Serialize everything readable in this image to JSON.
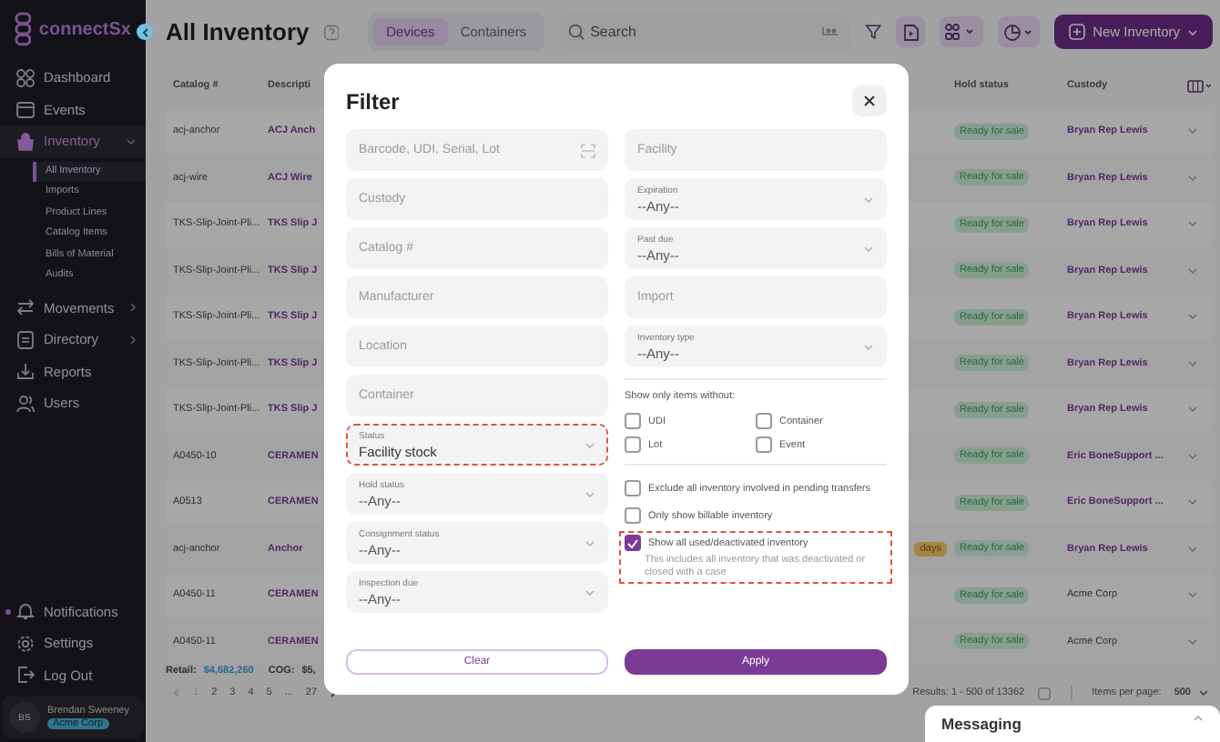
{
  "sidebar": {
    "brand": "connectSx",
    "nav": [
      {
        "label": "Dashboard",
        "selected": false
      },
      {
        "label": "Events",
        "selected": false
      },
      {
        "label": "Inventory",
        "selected": true,
        "expanded": true,
        "children": [
          {
            "label": "All Inventory",
            "selected": true
          },
          {
            "label": "Imports",
            "selected": false
          },
          {
            "label": "Product Lines",
            "selected": false
          },
          {
            "label": "Catalog Items",
            "selected": false
          },
          {
            "label": "Bills of Material",
            "selected": false
          },
          {
            "label": "Audits",
            "selected": false
          }
        ]
      },
      {
        "label": "Movements",
        "selected": false,
        "expanded": false
      },
      {
        "label": "Directory",
        "selected": false,
        "expanded": false
      },
      {
        "label": "Reports",
        "selected": false
      },
      {
        "label": "Users",
        "selected": false
      }
    ],
    "bottom_nav": [
      {
        "label": "Notifications",
        "unread": true
      },
      {
        "label": "Settings",
        "unread": false
      },
      {
        "label": "Log Out",
        "unread": false
      }
    ],
    "user": {
      "initials": "BS",
      "name": "Brendan Sweeney",
      "org": "Acme Corp"
    }
  },
  "header": {
    "title": "All Inventory",
    "tabs": [
      {
        "label": "Devices",
        "selected": true
      },
      {
        "label": "Containers",
        "selected": false
      }
    ],
    "search": {
      "placeholder": "Search"
    },
    "new_button": "New Inventory"
  },
  "table": {
    "columns": {
      "catalog": "Catalog #",
      "description": "Descripti",
      "hold_status": "Hold status",
      "custody": "Custody"
    },
    "rows": [
      {
        "catalog": "acj-anchor",
        "description": "ACJ Anch",
        "hold_status": "Ready for sale",
        "custody": "Bryan Rep Lewis",
        "custody_link": true
      },
      {
        "catalog": "acj-wire",
        "description": "ACJ Wire",
        "hold_status": "Ready for sale",
        "custody": "Bryan Rep Lewis",
        "custody_link": true
      },
      {
        "catalog": "TKS-Slip-Joint-Pli...",
        "description": "TKS Slip J",
        "hold_status": "Ready for sale",
        "custody": "Bryan Rep Lewis",
        "custody_link": true
      },
      {
        "catalog": "TKS-Slip-Joint-Pli...",
        "description": "TKS Slip J",
        "hold_status": "Ready for sale",
        "custody": "Bryan Rep Lewis",
        "custody_link": true
      },
      {
        "catalog": "TKS-Slip-Joint-Pli...",
        "description": "TKS Slip J",
        "hold_status": "Ready for sale",
        "custody": "Bryan Rep Lewis",
        "custody_link": true
      },
      {
        "catalog": "TKS-Slip-Joint-Pli...",
        "description": "TKS Slip J",
        "hold_status": "Ready for sale",
        "custody": "Bryan Rep Lewis",
        "custody_link": true
      },
      {
        "catalog": "TKS-Slip-Joint-Pli...",
        "description": "TKS Slip J",
        "hold_status": "Ready for sale",
        "custody": "Bryan Rep Lewis",
        "custody_link": true
      },
      {
        "catalog": "A0450-10",
        "description": "CERAMEN",
        "hold_status": "Ready for sale",
        "custody": "Eric BoneSupport ...",
        "custody_link": true
      },
      {
        "catalog": "A0513",
        "description": "CERAMEN",
        "hold_status": "Ready for sale",
        "custody": "Eric BoneSupport ...",
        "custody_link": true
      },
      {
        "catalog": "acj-anchor",
        "description": "Anchor",
        "due_badge": "days",
        "hold_status": "Ready for sale",
        "custody": "Bryan Rep Lewis",
        "custody_link": true
      },
      {
        "catalog": "A0450-11",
        "description": "CERAMEN",
        "hold_status": "Ready for sale",
        "custody": "Acme Corp",
        "custody_link": false
      },
      {
        "catalog": "A0450-11",
        "description": "CERAMEN",
        "hold_status": "Ready for sale",
        "custody": "Acme Corp",
        "custody_link": false
      }
    ]
  },
  "totals": {
    "retail_label": "Retail:",
    "retail_value": "$4,682,260",
    "cog_label": "COG:",
    "cog_value": "$5,"
  },
  "pagination": {
    "pages": [
      {
        "label": "1",
        "selected": true
      },
      {
        "label": "2",
        "selected": false
      },
      {
        "label": "3",
        "selected": false
      },
      {
        "label": "4",
        "selected": false
      },
      {
        "label": "5",
        "selected": false
      },
      {
        "label": "...",
        "selected": false
      },
      {
        "label": "27",
        "selected": false
      }
    ],
    "results": "Results: 1 - 500 of 13362",
    "per_page_label": "Items per page:",
    "per_page": "500"
  },
  "filter": {
    "title": "Filter",
    "left_fields": [
      {
        "kind": "text",
        "placeholder": "Barcode, UDI, Serial, Lot",
        "scan": true,
        "highlighted": false
      },
      {
        "kind": "text",
        "placeholder": "Custody",
        "scan": false,
        "highlighted": false
      },
      {
        "kind": "text",
        "placeholder": "Catalog #",
        "scan": false,
        "highlighted": false
      },
      {
        "kind": "text",
        "placeholder": "Manufacturer",
        "scan": false,
        "highlighted": false
      },
      {
        "kind": "text",
        "placeholder": "Location",
        "scan": false,
        "highlighted": false
      },
      {
        "kind": "text",
        "placeholder": "Container",
        "scan": false,
        "highlighted": false
      },
      {
        "kind": "select",
        "label": "Status",
        "value": "Facility stock",
        "highlighted": true
      },
      {
        "kind": "select",
        "label": "Hold status",
        "value": "--Any--",
        "highlighted": false
      },
      {
        "kind": "select",
        "label": "Consignment status",
        "value": "--Any--",
        "highlighted": false
      },
      {
        "kind": "select",
        "label": "Inspection due",
        "value": "--Any--",
        "highlighted": false
      }
    ],
    "right_fields": [
      {
        "kind": "text",
        "placeholder": "Facility",
        "scan": false,
        "highlighted": false
      },
      {
        "kind": "select",
        "label": "Expiration",
        "value": "--Any--",
        "highlighted": false
      },
      {
        "kind": "select",
        "label": "Past due",
        "value": "--Any--",
        "highlighted": false
      },
      {
        "kind": "text",
        "placeholder": "Import",
        "scan": false,
        "highlighted": false
      },
      {
        "kind": "select",
        "label": "Inventory type",
        "value": "--Any--",
        "highlighted": false
      }
    ],
    "without_label": "Show only items without:",
    "without": [
      {
        "label": "UDI",
        "checked": false
      },
      {
        "label": "Container",
        "checked": false
      },
      {
        "label": "Lot",
        "checked": false
      },
      {
        "label": "Event",
        "checked": false
      }
    ],
    "options": [
      {
        "label": "Exclude all inventory involved in pending transfers",
        "checked": false,
        "highlighted": false
      },
      {
        "label": "Only show billable inventory",
        "checked": false,
        "highlighted": false
      },
      {
        "label": "Show all used/deactivated inventory",
        "checked": true,
        "highlighted": true,
        "description": "This includes all inventory that was deactivated or closed with a case"
      }
    ],
    "clear": "Clear",
    "apply": "Apply"
  },
  "messaging": {
    "title": "Messaging"
  }
}
